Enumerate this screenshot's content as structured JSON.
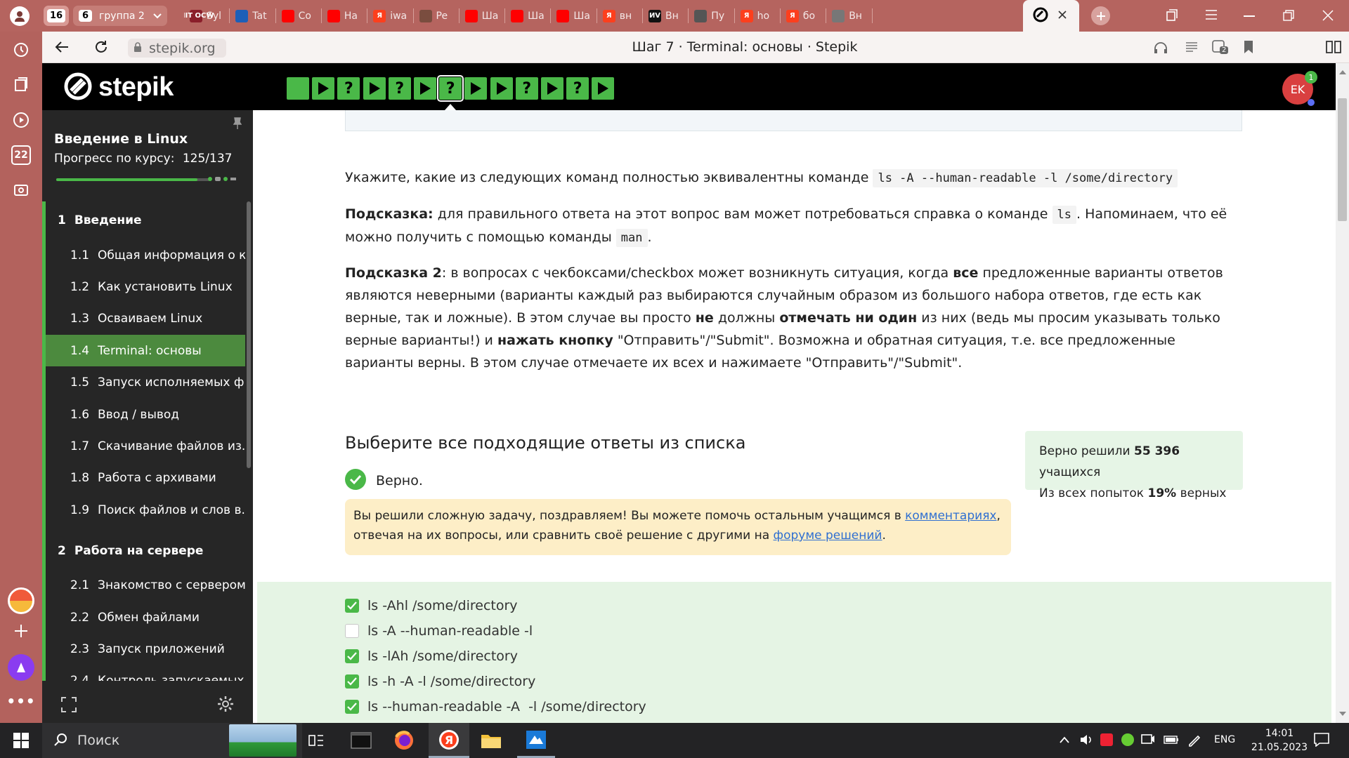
{
  "browser": {
    "tab_group_count": "16",
    "group_tab": {
      "count": "6",
      "label": "группа 2"
    },
    "tabs": [
      {
        "label": "Syl",
        "fav": "MIT OCW",
        "color": "#8a1e2a"
      },
      {
        "label": "Tat",
        "fav": "",
        "color": "#1d5fb8"
      },
      {
        "label": "Co",
        "fav": "",
        "color": "#ff0000"
      },
      {
        "label": "Ha",
        "fav": "",
        "color": "#ff0000"
      },
      {
        "label": "iwa",
        "fav": "Я",
        "color": "#fc3f1d"
      },
      {
        "label": "Pe",
        "fav": "",
        "color": "#7a4d3f"
      },
      {
        "label": "Ша",
        "fav": "",
        "color": "#ff0000"
      },
      {
        "label": "Ша",
        "fav": "",
        "color": "#ff0000"
      },
      {
        "label": "Ша",
        "fav": "",
        "color": "#ff0000"
      },
      {
        "label": "вн",
        "fav": "Я",
        "color": "#fc3f1d"
      },
      {
        "label": "Вн",
        "fav": "ИV",
        "color": "#111111"
      },
      {
        "label": "Пу",
        "fav": "",
        "color": "#555555"
      },
      {
        "label": "ho",
        "fav": "Я",
        "color": "#fc3f1d"
      },
      {
        "label": "бо",
        "fav": "Я",
        "color": "#fc3f1d"
      },
      {
        "label": "Вн",
        "fav": "",
        "color": "#777777"
      }
    ],
    "address": "stepik.org",
    "page_title": "Шаг 7 · Terminal: основы · Stepik",
    "ext_badge": "2"
  },
  "stepik": {
    "logo": "stepik",
    "avatar_initials": "EK",
    "notification_count": "1",
    "steps": [
      {
        "kind": "text"
      },
      {
        "kind": "play"
      },
      {
        "kind": "quiz"
      },
      {
        "kind": "play"
      },
      {
        "kind": "quiz"
      },
      {
        "kind": "play"
      },
      {
        "kind": "quiz",
        "current": true
      },
      {
        "kind": "play"
      },
      {
        "kind": "play"
      },
      {
        "kind": "quiz"
      },
      {
        "kind": "play"
      },
      {
        "kind": "quiz"
      },
      {
        "kind": "play"
      }
    ]
  },
  "sidebar": {
    "course_title": "Введение в Linux",
    "progress_label": "Прогресс по курсу:",
    "progress_value": "125/137",
    "progress": {
      "done": 125,
      "total": 137
    },
    "sections": [
      {
        "num": "1",
        "title": "Введение",
        "lessons": [
          {
            "num": "1.1",
            "title": "Общая информация о к..."
          },
          {
            "num": "1.2",
            "title": "Как установить Linux"
          },
          {
            "num": "1.3",
            "title": "Осваиваем Linux"
          },
          {
            "num": "1.4",
            "title": "Terminal: основы",
            "active": true
          },
          {
            "num": "1.5",
            "title": "Запуск исполняемых ф..."
          },
          {
            "num": "1.6",
            "title": "Ввод / вывод"
          },
          {
            "num": "1.7",
            "title": "Скачивание файлов из..."
          },
          {
            "num": "1.8",
            "title": "Работа с архивами"
          },
          {
            "num": "1.9",
            "title": "Поиск файлов и слов в..."
          }
        ]
      },
      {
        "num": "2",
        "title": "Работа на сервере",
        "lessons": [
          {
            "num": "2.1",
            "title": "Знакомство с сервером"
          },
          {
            "num": "2.2",
            "title": "Обмен файлами"
          },
          {
            "num": "2.3",
            "title": "Запуск приложений"
          },
          {
            "num": "2.4",
            "title": "Контроль запускаемых..."
          }
        ]
      }
    ]
  },
  "content": {
    "question_pre": "Укажите, какие из следующих команд полностью эквивалентны команде",
    "question_code": "ls -A --human-readable -l /some/directory",
    "hint1_label": "Подсказка:",
    "hint1_a": "для правильного ответа на этот вопрос вам может потребоваться справка о команде",
    "hint1_code1": "ls",
    "hint1_b": ". Напоминаем, что её можно получить с помощью команды",
    "hint1_code2": "man",
    "hint1_c": ".",
    "hint2_label": "Подсказка 2",
    "hint2_a": ": в вопросах с чекбоксами/checkbox может возникнуть ситуация, когда",
    "hint2_b1": "все",
    "hint2_c": "предложенные варианты ответов являются неверными (варианты каждый раз выбираются случайным образом из большого набора ответов, где есть как верные, так и ложные). В этом случае вы просто",
    "hint2_b2": "не",
    "hint2_d": "должны",
    "hint2_b3": "отмечать ни один",
    "hint2_e": "из них (ведь мы просим указывать только верные варианты!) и",
    "hint2_b4": "нажать кнопку",
    "hint2_f": "\"Отправить\"/\"Submit\". Возможна и обратная ситуация, т.е. все предложенные варианты верны. В этом случае отмечаете их всех и нажимаете \"Отправить\"/\"Submit\".",
    "task_title": "Выберите все подходящие ответы из списка",
    "status": "Верно.",
    "stats_line1_pre": "Верно решили",
    "stats_solved": "55 396",
    "stats_line1_post": "учащихся",
    "stats_line2_pre": "Из всех попыток",
    "stats_percent": "19%",
    "stats_line2_post": "верных",
    "congrats_a": "Вы решили сложную задачу, поздравляем! Вы можете помочь остальным учащимся в",
    "congrats_link1": "комментариях",
    "congrats_b": ", отвечая на их вопросы, или сравнить своё решение с другими на",
    "congrats_link2": "форуме решений",
    "congrats_c": ".",
    "answers": [
      {
        "label": "ls -Ahl /some/directory",
        "checked": true
      },
      {
        "label": "ls -A --human-readable -l",
        "checked": false
      },
      {
        "label": "ls -lAh /some/directory",
        "checked": true
      },
      {
        "label": "ls -h -A -l /some/directory",
        "checked": true
      },
      {
        "label": "ls --human-readable -A  -l /some/directory",
        "checked": true
      }
    ]
  },
  "taskbar": {
    "search_placeholder": "Поиск",
    "lang": "ENG",
    "time": "14:01",
    "date": "21.05.2023"
  }
}
